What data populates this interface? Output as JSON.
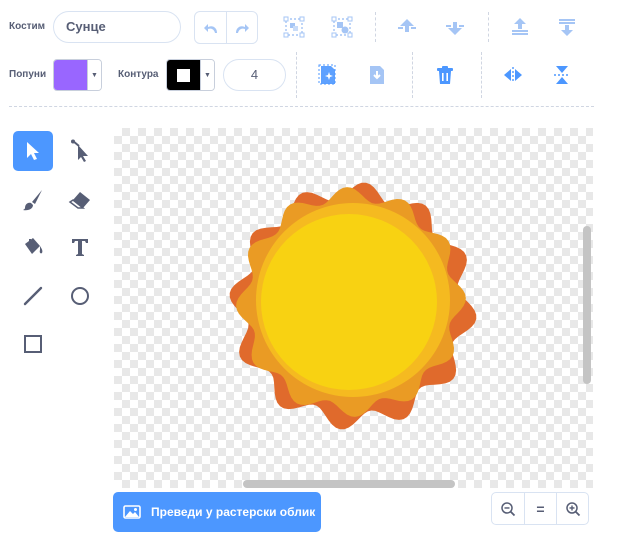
{
  "costume": {
    "label": "Костим",
    "name": "Сунце"
  },
  "fill": {
    "label": "Попуни",
    "color": "#9966ff"
  },
  "outline": {
    "label": "Контура",
    "color": "#000000",
    "width": "4"
  },
  "convert_button": {
    "label": "Преведи у растерски облик"
  },
  "zoom": {
    "reset_label": "="
  },
  "colors": {
    "accent": "#4c97ff",
    "sun_outer": "#e06a2c",
    "sun_mid": "#ea9b24",
    "sun_inner_ring": "#f5ba20",
    "sun_core": "#f8d212"
  },
  "tools": [
    "select",
    "reshape",
    "brush",
    "eraser",
    "fill",
    "text",
    "line",
    "circle",
    "rectangle"
  ]
}
